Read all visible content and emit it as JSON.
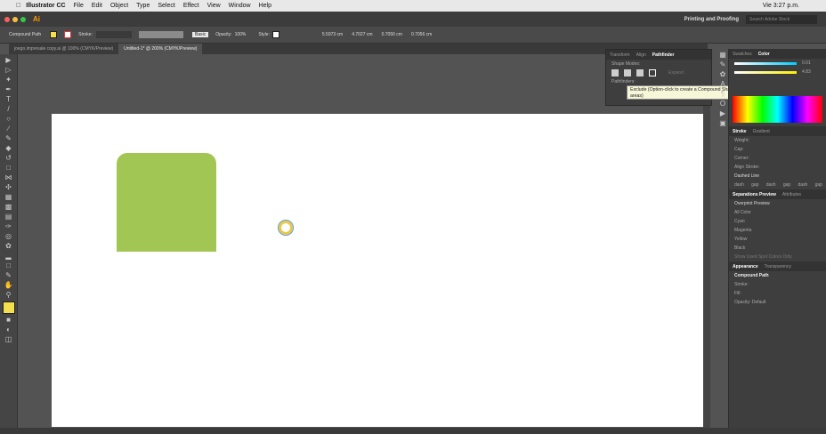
{
  "menubar": {
    "app": "Illustrator CC",
    "items": [
      "File",
      "Edit",
      "Object",
      "Type",
      "Select",
      "Effect",
      "View",
      "Window",
      "Help"
    ],
    "clock": "Vie 3:27 p.m."
  },
  "appbar": {
    "logo": "Ai",
    "workspace": "Printing and Proofing",
    "search_placeholder": "Search Adobe Stock"
  },
  "control": {
    "selection": "Compound Path",
    "stroke_label": "Stroke:",
    "brush": "Basic",
    "opacity_label": "Opacity:",
    "opacity": "100%",
    "style_label": "Style:",
    "x": "5.5973 cm",
    "y": "4.7027 cm",
    "w": "0.7056 cm",
    "h": "0.7056 cm"
  },
  "tabs": [
    "joego.impresale copy.ai @ 100% (CMYK/Preview)",
    "Untitled-1* @ 200% (CMYK/Preview)"
  ],
  "pathfinder": {
    "tabs": [
      "Transform",
      "Align",
      "Pathfinder"
    ],
    "shape_modes": "Shape Modes:",
    "pathfinders": "Pathfinders:",
    "expand": "Expand"
  },
  "tooltip": "Exclude (Option-click to create a Compound Shape and exclude overlapping shape areas)",
  "color": {
    "tabs": [
      "Swatches",
      "Color"
    ],
    "c": "0.01",
    "y": "4.83"
  },
  "stroke": {
    "tabs": [
      "Stroke",
      "Gradient"
    ],
    "weight": "Weight:",
    "cap": "Cap:",
    "corner": "Corner:",
    "limit": "Limit:",
    "align": "Align Stroke:",
    "dashed": "Dashed Line",
    "dash_labels": [
      "dash",
      "gap",
      "dash",
      "gap",
      "dash",
      "gap"
    ]
  },
  "separations": {
    "tabs": [
      "Separations Preview",
      "Attributes"
    ],
    "overprint": "Overprint Preview",
    "inks": [
      "All Color",
      "Cyan",
      "Magenta",
      "Yellow",
      "Black"
    ],
    "spot": "Show Used Spot Colors Only"
  },
  "appearance": {
    "tabs": [
      "Appearance",
      "Transparency"
    ],
    "title": "Compound Path",
    "stroke": "Stroke:",
    "fill": "Fill:",
    "opacity": "Opacity: Default"
  }
}
